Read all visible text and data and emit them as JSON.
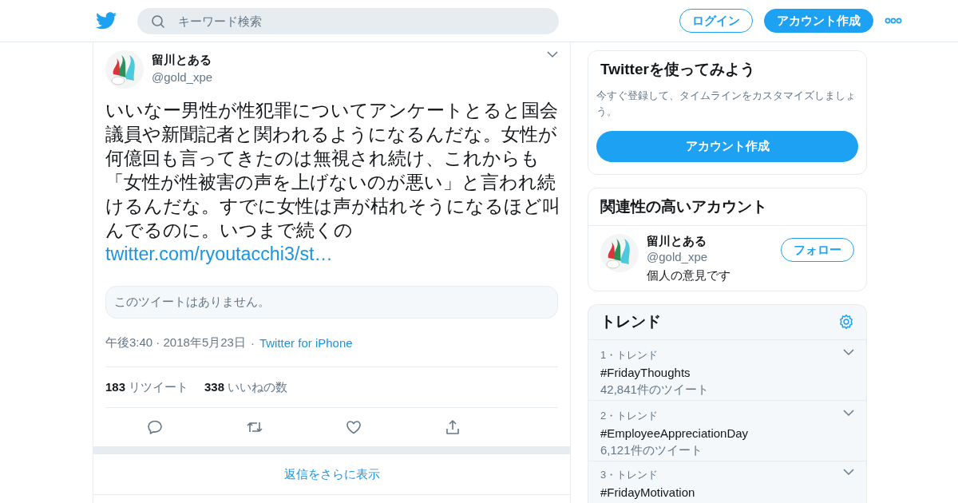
{
  "header": {
    "search": {
      "placeholder": "キーワード検索"
    },
    "login_button": "ログイン",
    "signup_button": "アカウント作成"
  },
  "tweet": {
    "author": {
      "name": "留川とある",
      "handle": "@gold_xpe"
    },
    "text": "いいなー男性が性犯罪についてアンケートとると国会議員や新聞記者と関われるようになるんだな。女性が何億回も言ってきたのは無視され続け、これからも「女性が性被害の声を上げないのが悪い」と言われ続けるんだな。すでに女性は声が枯れそうになるほど叫んでるのに。いつまで続くの",
    "link": "twitter.com/ryoutacchi3/st…",
    "quoted_notice": "このツイートはありません。",
    "time": "午後3:40 · 2018年5月23日",
    "separator": "·",
    "source": "Twitter for iPhone",
    "stats": [
      {
        "count": "183",
        "label": "リツイート"
      },
      {
        "count": "338",
        "label": "いいねの数"
      }
    ]
  },
  "more_replies": "返信をさらに表示",
  "signup_card": {
    "title": "Twitterを使ってみよう",
    "text": "今すぐ登録して、タイムラインをカスタマイズしましょう。",
    "button": "アカウント作成"
  },
  "related_card": {
    "title": "関連性の高いアカウント",
    "accounts": [
      {
        "name": "留川とある",
        "handle": "@gold_xpe",
        "bio": "個人の意見です",
        "follow_button": "フォロー"
      }
    ]
  },
  "trends": {
    "title": "トレンド",
    "items": [
      {
        "rank_label": "1・トレンド",
        "name": "#FridayThoughts",
        "tweet_count": "42,841件のツイート"
      },
      {
        "rank_label": "2・トレンド",
        "name": "#EmployeeAppreciationDay",
        "tweet_count": "6,121件のツイート"
      },
      {
        "rank_label": "3・トレンド",
        "name": "#FridayMotivation"
      }
    ]
  }
}
